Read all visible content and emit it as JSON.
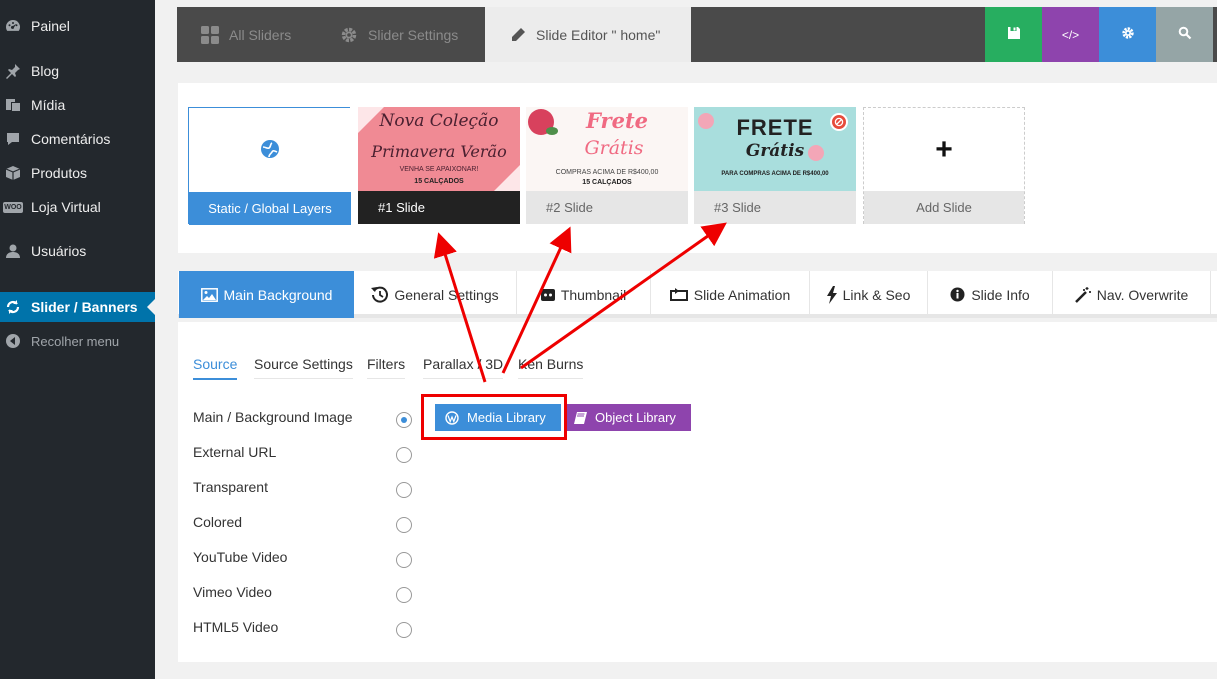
{
  "sidebar": {
    "items": [
      {
        "label": "Painel",
        "icon": "dashboard-icon"
      },
      {
        "label": "Blog",
        "icon": "pin-icon"
      },
      {
        "label": "Mídia",
        "icon": "media-icon"
      },
      {
        "label": "Comentários",
        "icon": "comment-icon"
      },
      {
        "label": "Produtos",
        "icon": "box-icon"
      },
      {
        "label": "Loja Virtual",
        "icon": "woo-icon",
        "badge": "WOO"
      },
      {
        "label": "Usuários",
        "icon": "user-icon"
      },
      {
        "label": "Slider / Banners",
        "icon": "refresh-icon"
      },
      {
        "label": "Recolher menu",
        "icon": "collapse-icon"
      }
    ]
  },
  "toolbar": {
    "tabs": [
      {
        "label": "All Sliders",
        "icon": "grid-icon"
      },
      {
        "label": "Slider Settings",
        "icon": "gear-icon"
      },
      {
        "label": "Slide Editor \" home\"",
        "icon": "pencil-icon"
      }
    ],
    "buttons": [
      {
        "name": "save",
        "icon": "save-icon",
        "color": "#27ae60"
      },
      {
        "name": "code",
        "icon": "code-icon",
        "label": "</>",
        "color": "#8e44ad"
      },
      {
        "name": "settings",
        "icon": "gear-icon",
        "color": "#3c8ed9"
      },
      {
        "name": "search",
        "icon": "search-icon",
        "color": "#95a5a6"
      }
    ]
  },
  "slides": {
    "static_label": "Static / Global Layers",
    "items": [
      {
        "label": "#1 Slide",
        "thumb_line1": "Nova Coleção",
        "thumb_line2": "Primavera Verão",
        "thumb_line3": "VENHA SE APAIXONAR!",
        "thumb_brand": "15 CALÇADOS"
      },
      {
        "label": "#2 Slide",
        "thumb_line1": "Frete",
        "thumb_line2": "Grátis",
        "thumb_line3": "COMPRAS ACIMA DE R$400,00",
        "thumb_brand": "15 CALÇADOS"
      },
      {
        "label": "#3 Slide",
        "thumb_line1": "FRETE",
        "thumb_line2": "Grátis",
        "thumb_line3": "PARA COMPRAS ACIMA DE R$400,00"
      }
    ],
    "add_label": "Add Slide",
    "add_symbol": "+"
  },
  "tabs": [
    {
      "label": "Main Background",
      "icon": "image-icon"
    },
    {
      "label": "General Settings",
      "icon": "history-icon"
    },
    {
      "label": "Thumbnail",
      "icon": "thumbnail-icon"
    },
    {
      "label": "Slide Animation",
      "icon": "animation-icon"
    },
    {
      "label": "Link & Seo",
      "icon": "bolt-icon"
    },
    {
      "label": "Slide Info",
      "icon": "info-icon"
    },
    {
      "label": "Nav. Overwrite",
      "icon": "wand-icon"
    }
  ],
  "subtabs": [
    "Source",
    "Source Settings",
    "Filters",
    "Parallax / 3D",
    "Ken Burns"
  ],
  "sources": [
    {
      "label": "Main / Background Image",
      "selected": true
    },
    {
      "label": "External URL",
      "selected": false
    },
    {
      "label": "Transparent",
      "selected": false
    },
    {
      "label": "Colored",
      "selected": false
    },
    {
      "label": "YouTube Video",
      "selected": false
    },
    {
      "label": "Vimeo Video",
      "selected": false
    },
    {
      "label": "HTML5 Video",
      "selected": false
    }
  ],
  "actions": {
    "media_library": "Media Library",
    "object_library": "Object Library"
  }
}
